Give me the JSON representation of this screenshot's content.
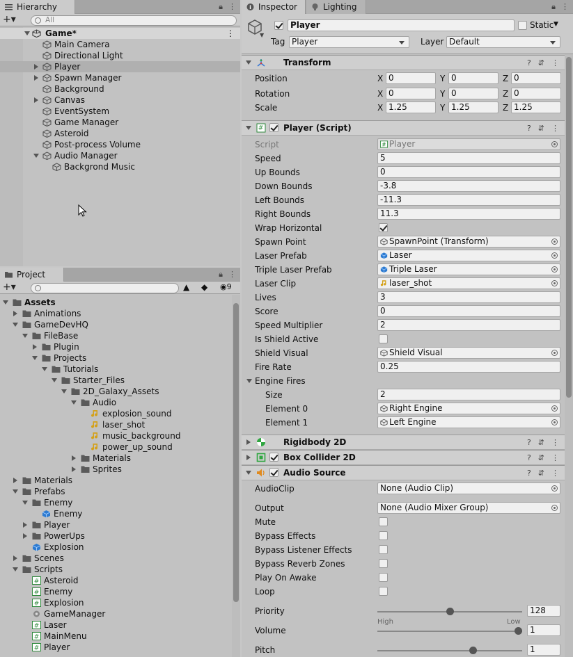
{
  "hierarchy": {
    "tab": "Hierarchy",
    "search_placeholder": "All",
    "scene": "Game*",
    "items": [
      {
        "label": "Main Camera"
      },
      {
        "label": "Directional Light"
      },
      {
        "label": "Player"
      },
      {
        "label": "Spawn Manager"
      },
      {
        "label": "Background"
      },
      {
        "label": "Canvas"
      },
      {
        "label": "EventSystem"
      },
      {
        "label": "Game Manager"
      },
      {
        "label": "Asteroid"
      },
      {
        "label": "Post-process Volume"
      },
      {
        "label": "Audio Manager"
      },
      {
        "label": "Backgrond Music"
      }
    ]
  },
  "project": {
    "tab": "Project",
    "hidden_count": "9",
    "items": [
      {
        "label": "Assets"
      },
      {
        "label": "Animations"
      },
      {
        "label": "GameDevHQ"
      },
      {
        "label": "FileBase"
      },
      {
        "label": "Plugin"
      },
      {
        "label": "Projects"
      },
      {
        "label": "Tutorials"
      },
      {
        "label": "Starter_Files"
      },
      {
        "label": "2D_Galaxy_Assets"
      },
      {
        "label": "Audio"
      },
      {
        "label": "explosion_sound"
      },
      {
        "label": "laser_shot"
      },
      {
        "label": "music_background"
      },
      {
        "label": "power_up_sound"
      },
      {
        "label": "Materials"
      },
      {
        "label": "Sprites"
      },
      {
        "label": "Materials"
      },
      {
        "label": "Prefabs"
      },
      {
        "label": "Enemy"
      },
      {
        "label": "Enemy"
      },
      {
        "label": "Player"
      },
      {
        "label": "PowerUps"
      },
      {
        "label": "Explosion"
      },
      {
        "label": "Scenes"
      },
      {
        "label": "Scripts"
      },
      {
        "label": "Asteroid"
      },
      {
        "label": "Enemy"
      },
      {
        "label": "Explosion"
      },
      {
        "label": "GameManager"
      },
      {
        "label": "Laser"
      },
      {
        "label": "MainMenu"
      },
      {
        "label": "Player"
      }
    ]
  },
  "inspector": {
    "tabs": [
      "Inspector",
      "Lighting"
    ],
    "object_name": "Player",
    "static_label": "Static",
    "tag_label": "Tag",
    "tag_value": "Player",
    "layer_label": "Layer",
    "layer_value": "Default",
    "transform": {
      "title": "Transform",
      "rows": [
        {
          "label": "Position",
          "x": "0",
          "y": "0",
          "z": "0"
        },
        {
          "label": "Rotation",
          "x": "0",
          "y": "0",
          "z": "0"
        },
        {
          "label": "Scale",
          "x": "1.25",
          "y": "1.25",
          "z": "1.25"
        }
      ],
      "axes": [
        "X",
        "Y",
        "Z"
      ]
    },
    "script": {
      "title": "Player (Script)",
      "rows": [
        {
          "label": "Script",
          "value": "Player"
        },
        {
          "label": "Speed",
          "value": "5"
        },
        {
          "label": "Up Bounds",
          "value": "0"
        },
        {
          "label": "Down Bounds",
          "value": "-3.8"
        },
        {
          "label": "Left Bounds",
          "value": "-11.3"
        },
        {
          "label": "Right Bounds",
          "value": "11.3"
        },
        {
          "label": "Wrap Horizontal",
          "value": ""
        },
        {
          "label": "Spawn Point",
          "value": "SpawnPoint (Transform)"
        },
        {
          "label": "Laser Prefab",
          "value": "Laser"
        },
        {
          "label": "Triple Laser Prefab",
          "value": "Triple Laser"
        },
        {
          "label": "Laser Clip",
          "value": "laser_shot"
        },
        {
          "label": "Lives",
          "value": "3"
        },
        {
          "label": "Score",
          "value": "0"
        },
        {
          "label": "Speed Multiplier",
          "value": "2"
        },
        {
          "label": "Is Shield Active",
          "value": ""
        },
        {
          "label": "Shield Visual",
          "value": "Shield Visual"
        },
        {
          "label": "Fire Rate",
          "value": "0.25"
        },
        {
          "label": "Engine Fires",
          "value": ""
        },
        {
          "label": "Size",
          "value": "2"
        },
        {
          "label": "Element 0",
          "value": "Right Engine"
        },
        {
          "label": "Element 1",
          "value": "Left Engine"
        }
      ]
    },
    "rigidbody": {
      "title": "Rigidbody 2D"
    },
    "collider": {
      "title": "Box Collider 2D"
    },
    "audio": {
      "title": "Audio Source",
      "audioclip_label": "AudioClip",
      "audioclip_value": "None (Audio Clip)",
      "output_label": "Output",
      "output_value": "None (Audio Mixer Group)",
      "toggles": [
        "Mute",
        "Bypass Effects",
        "Bypass Listener Effects",
        "Bypass Reverb Zones",
        "Play On Awake",
        "Loop"
      ],
      "priority_label": "Priority",
      "priority_value": "128",
      "priority_level": 0.5,
      "high_label": "High",
      "low_label": "Low",
      "volume_label": "Volume",
      "volume_value": "1",
      "volume_level": 1.0,
      "pitch_label": "Pitch",
      "pitch_value": "1",
      "pitch_level": 0.67
    }
  }
}
